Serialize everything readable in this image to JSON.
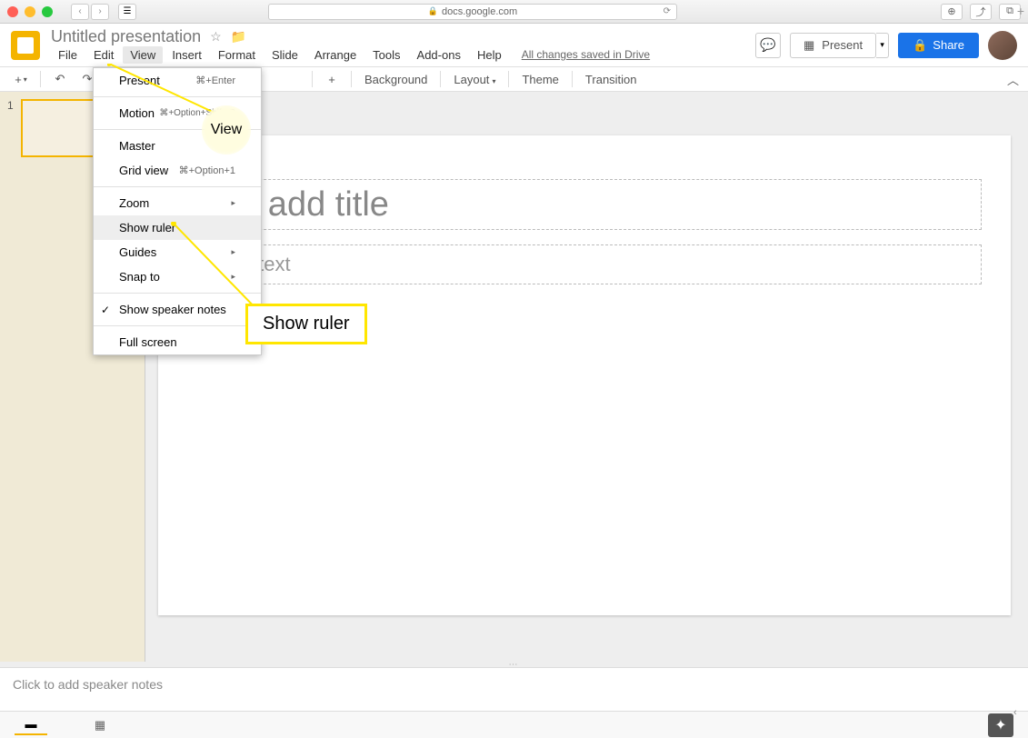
{
  "titlebar": {
    "url": "docs.google.com"
  },
  "header": {
    "doc_title": "Untitled presentation",
    "present_label": "Present",
    "share_label": "Share"
  },
  "menubar": {
    "items": [
      "File",
      "Edit",
      "View",
      "Insert",
      "Format",
      "Slide",
      "Arrange",
      "Tools",
      "Add-ons",
      "Help"
    ],
    "save_status": "All changes saved in Drive"
  },
  "toolbar": {
    "background_label": "Background",
    "layout_label": "Layout",
    "theme_label": "Theme",
    "transition_label": "Transition"
  },
  "dropdown": {
    "present": {
      "label": "Present",
      "shortcut": "⌘+Enter"
    },
    "motion": {
      "label": "Motion",
      "shortcut": "⌘+Option+Shift+B"
    },
    "master": {
      "label": "Master"
    },
    "gridview": {
      "label": "Grid view",
      "shortcut": "⌘+Option+1"
    },
    "zoom": {
      "label": "Zoom"
    },
    "showruler": {
      "label": "Show ruler"
    },
    "guides": {
      "label": "Guides"
    },
    "snapto": {
      "label": "Snap to"
    },
    "speakernotes": {
      "label": "Show speaker notes"
    },
    "fullscreen": {
      "label": "Full screen"
    }
  },
  "callouts": {
    "view_label": "View",
    "ruler_label": "Show ruler"
  },
  "slide": {
    "number": "1",
    "title_placeholder": "k to add title",
    "subtitle_placeholder": "o add text"
  },
  "notes": {
    "placeholder": "Click to add speaker notes"
  }
}
